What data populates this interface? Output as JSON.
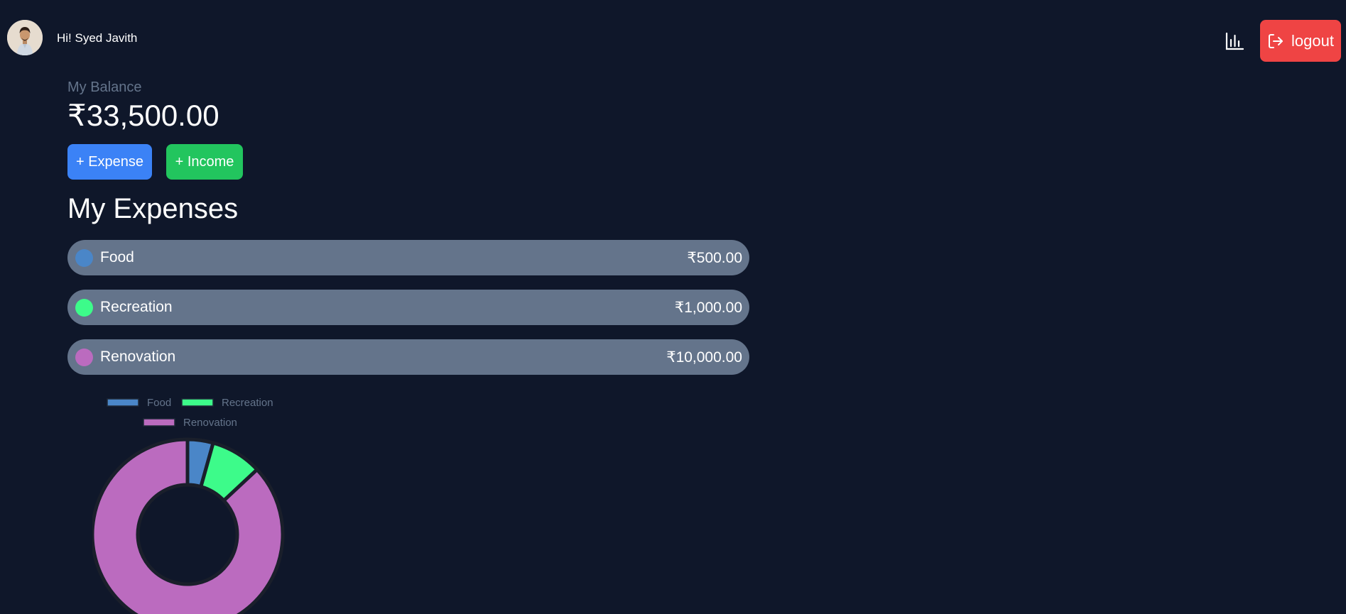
{
  "header": {
    "greeting": "Hi! Syed Javith",
    "logout_label": "logout"
  },
  "balance": {
    "label": "My Balance",
    "amount": "₹33,500.00"
  },
  "actions": {
    "expense_label": "+ Expense",
    "income_label": "+ Income"
  },
  "expenses": {
    "title": "My Expenses",
    "items": [
      {
        "name": "Food",
        "amount": "₹500.00",
        "color": "#4a86c8"
      },
      {
        "name": "Recreation",
        "amount": "₹1,000.00",
        "color": "#3dfb8a"
      },
      {
        "name": "Renovation",
        "amount": "₹10,000.00",
        "color": "#bb6bbf"
      }
    ]
  },
  "icons": {
    "stats": "bar-chart-icon",
    "logout": "logout-icon"
  },
  "colors": {
    "background": "#0f172a",
    "expense_button": "#3b82f6",
    "income_button": "#22c55e",
    "logout_button": "#ef4444",
    "row_background": "#64748b"
  },
  "chart_data": {
    "type": "pie",
    "donut": true,
    "categories": [
      "Food",
      "Recreation",
      "Renovation"
    ],
    "values": [
      500,
      1000,
      10000
    ],
    "colors": [
      "#4a86c8",
      "#3dfb8a",
      "#bb6bbf"
    ],
    "legend": "top"
  }
}
